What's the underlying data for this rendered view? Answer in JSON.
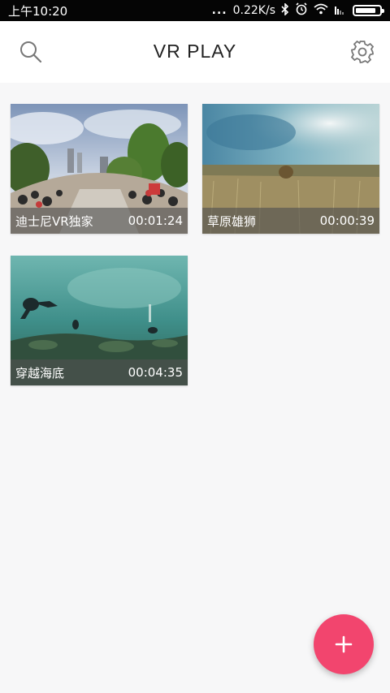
{
  "status_bar": {
    "time": "上午10:20",
    "dots": "...",
    "speed": "0.22K/s",
    "battery_level": 0.85,
    "icons": [
      "bluetooth-icon",
      "alarm-icon",
      "wifi-icon",
      "sim-icon",
      "battery-icon"
    ]
  },
  "header": {
    "title": "VR PLAY",
    "left_icon": "search-icon",
    "right_icon": "gear-icon"
  },
  "videos": [
    {
      "title": "迪士尼VR独家",
      "duration": "00:01:24",
      "scene": "theme-park"
    },
    {
      "title": "草原雄狮",
      "duration": "00:00:39",
      "scene": "savanna"
    },
    {
      "title": "穿越海底",
      "duration": "00:04:35",
      "scene": "underwater"
    }
  ],
  "fab": {
    "icon": "plus-icon"
  },
  "colors": {
    "accent": "#f2456e",
    "background": "#f7f7f8",
    "header": "#ffffff",
    "status_bar": "#050505"
  }
}
